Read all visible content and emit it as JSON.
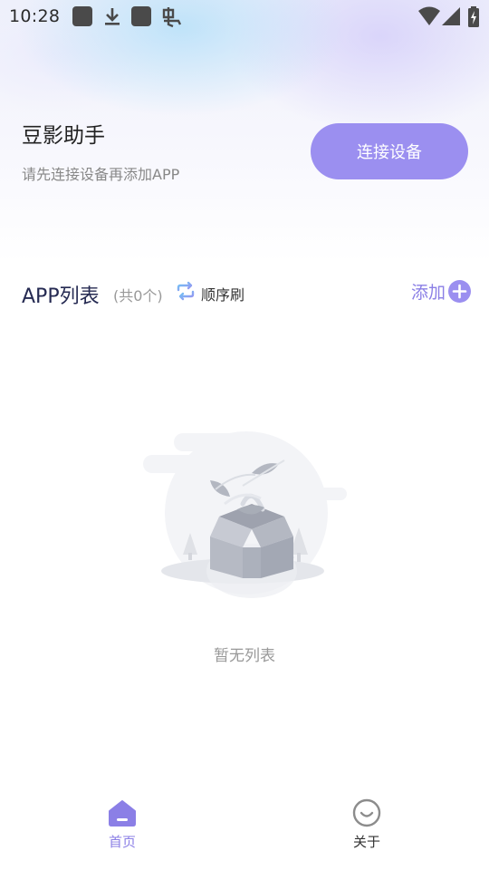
{
  "status_bar": {
    "time": "10:28",
    "icons": [
      "notification-square-icon",
      "download-icon",
      "notification-square-icon",
      "bug-icon",
      "wifi-icon",
      "signal-icon",
      "battery-charging-icon"
    ]
  },
  "header": {
    "title": "豆影助手",
    "subtitle": "请先连接设备再添加APP",
    "connect_button": "连接设备"
  },
  "app_list": {
    "title": "APP列表",
    "count": "(共0个)",
    "order_label": "顺序刷",
    "add_label": "添加",
    "empty_text": "暂无列表"
  },
  "bottom_nav": {
    "items": [
      {
        "label": "首页",
        "icon": "home-icon",
        "active": true
      },
      {
        "label": "关于",
        "icon": "smile-icon",
        "active": false
      }
    ]
  },
  "colors": {
    "accent": "#9b8ff0",
    "accent_text": "#8b7fe6",
    "title_dark": "#252a52"
  }
}
